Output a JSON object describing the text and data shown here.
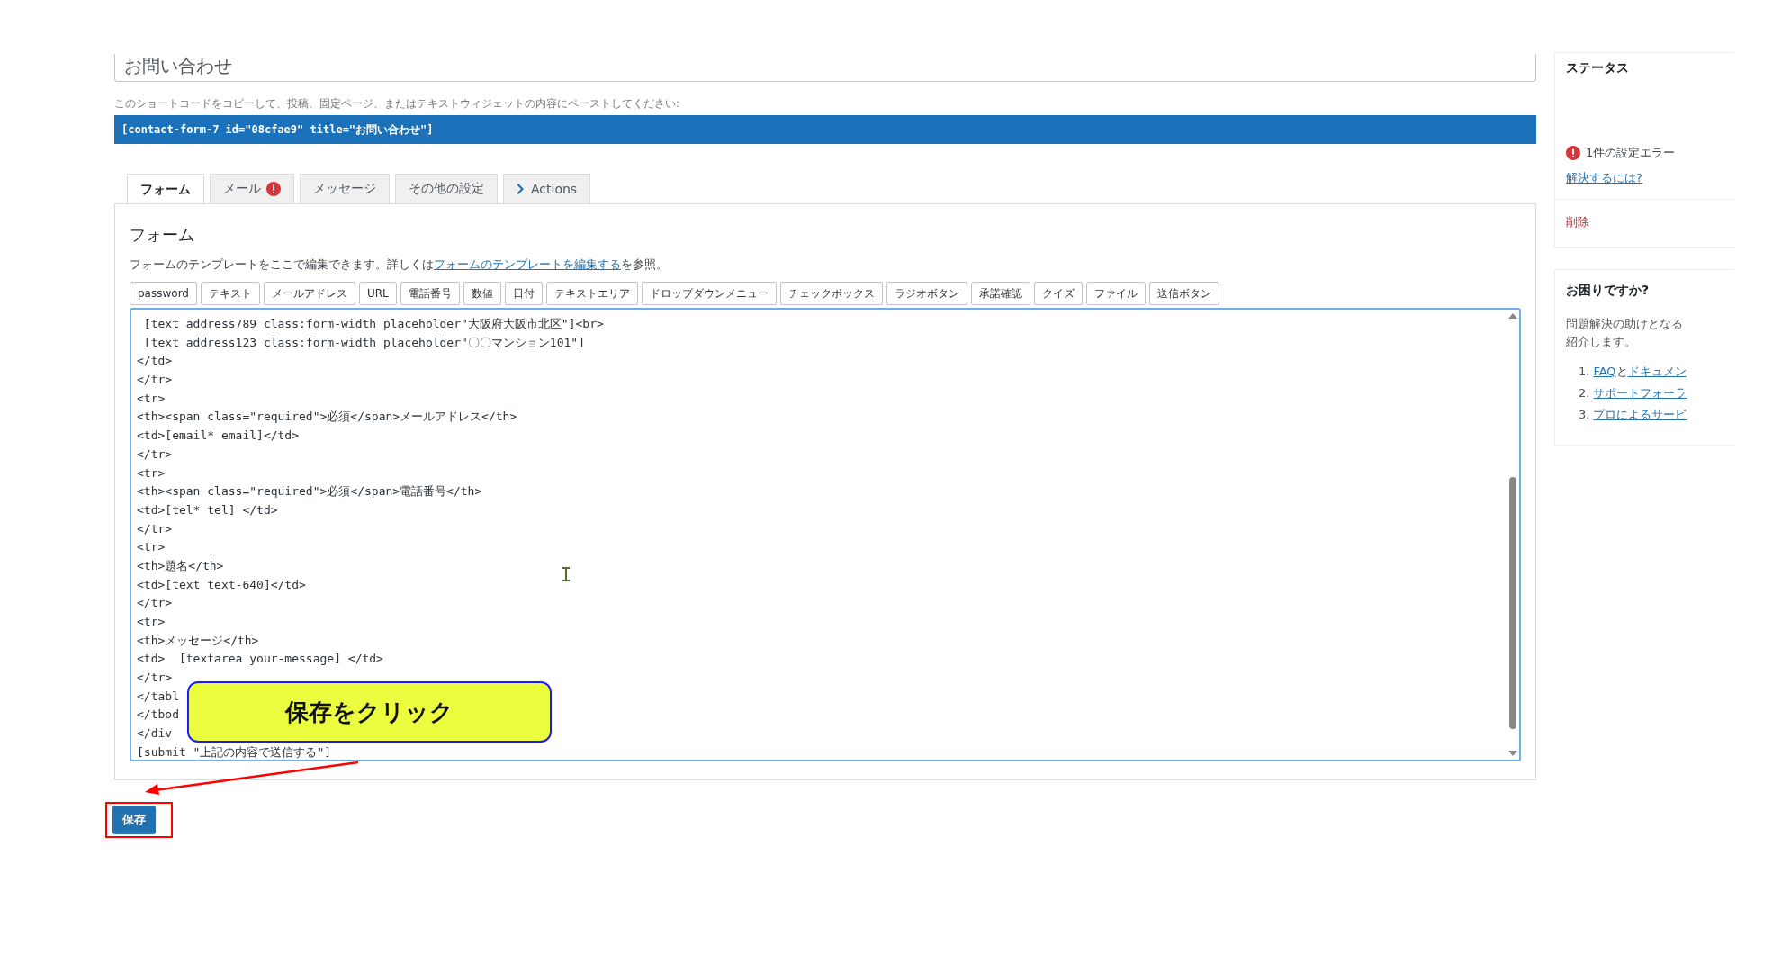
{
  "title_field": {
    "value": "お問い合わせ"
  },
  "shortcode": {
    "label": "このショートコードをコピーして、投稿、固定ページ、またはテキストウィジェットの内容にペーストしてください:",
    "value": "[contact-form-7 id=\"08cfae9\" title=\"お問い合わせ\"]"
  },
  "tabs": [
    {
      "label": "フォーム",
      "selected": true,
      "error": false,
      "kind": "plain"
    },
    {
      "label": "メール",
      "selected": false,
      "error": true,
      "kind": "plain"
    },
    {
      "label": "メッセージ",
      "selected": false,
      "error": false,
      "kind": "plain"
    },
    {
      "label": "その他の設定",
      "selected": false,
      "error": false,
      "kind": "plain"
    },
    {
      "label": "Actions",
      "selected": false,
      "error": false,
      "kind": "actions"
    }
  ],
  "panel": {
    "heading": "フォーム",
    "description": {
      "text": "フォームのテンプレートをここで編集できます。詳しくは",
      "link": "フォームのテンプレートを編集する",
      "suffix": "を参照。"
    },
    "tag_buttons": [
      "password",
      "テキスト",
      "メールアドレス",
      "URL",
      "電話番号",
      "数値",
      "日付",
      "テキストエリア",
      "ドロップダウンメニュー",
      "チェックボックス",
      "ラジオボタン",
      "承諾確認",
      "クイズ",
      "ファイル",
      "送信ボタン"
    ],
    "code_lines": [
      " [text address789 class:form-width placeholder\"大阪府大阪市北区\"]<br>",
      " [text address123 class:form-width placeholder\"〇〇マンション101\"]",
      "</td>",
      "</tr>",
      "<tr>",
      "<th><span class=\"required\">必須</span>メールアドレス</th>",
      "<td>[email* email]</td>",
      "</tr>",
      "<tr>",
      "<th><span class=\"required\">必須</span>電話番号</th>",
      "<td>[tel* tel] </td>",
      "</tr>",
      "<tr>",
      "<th>題名</th>",
      "<td>[text text-640]</td>",
      "</tr>",
      "<tr>",
      "<th>メッセージ</th>",
      "<td>  [textarea your-message] </td>",
      "</tr>",
      "</tabl",
      "</tbod",
      "</div",
      "[submit \"上記の内容で送信する\"]"
    ]
  },
  "callout": {
    "text": "保存をクリック"
  },
  "save_button": {
    "label": "保存"
  },
  "sidebar": {
    "status": {
      "heading": "ステータス",
      "error_text": "1件の設定エラー",
      "help_link": "解決するには?",
      "delete_link": "削除"
    },
    "help": {
      "heading": "お困りですか?",
      "lines": [
        "問題解決の助けとなる",
        "紹介します。"
      ],
      "items": [
        {
          "number": "1.",
          "segments": [
            {
              "text": "FAQ",
              "link": true
            },
            {
              "text": "と",
              "link": false
            },
            {
              "text": "ドキュメン",
              "link": true
            }
          ]
        },
        {
          "number": "2.",
          "segments": [
            {
              "text": "サポートフォーラ",
              "link": true
            }
          ]
        },
        {
          "number": "3.",
          "segments": [
            {
              "text": "プロによるサービ",
              "link": true
            }
          ]
        }
      ]
    }
  }
}
